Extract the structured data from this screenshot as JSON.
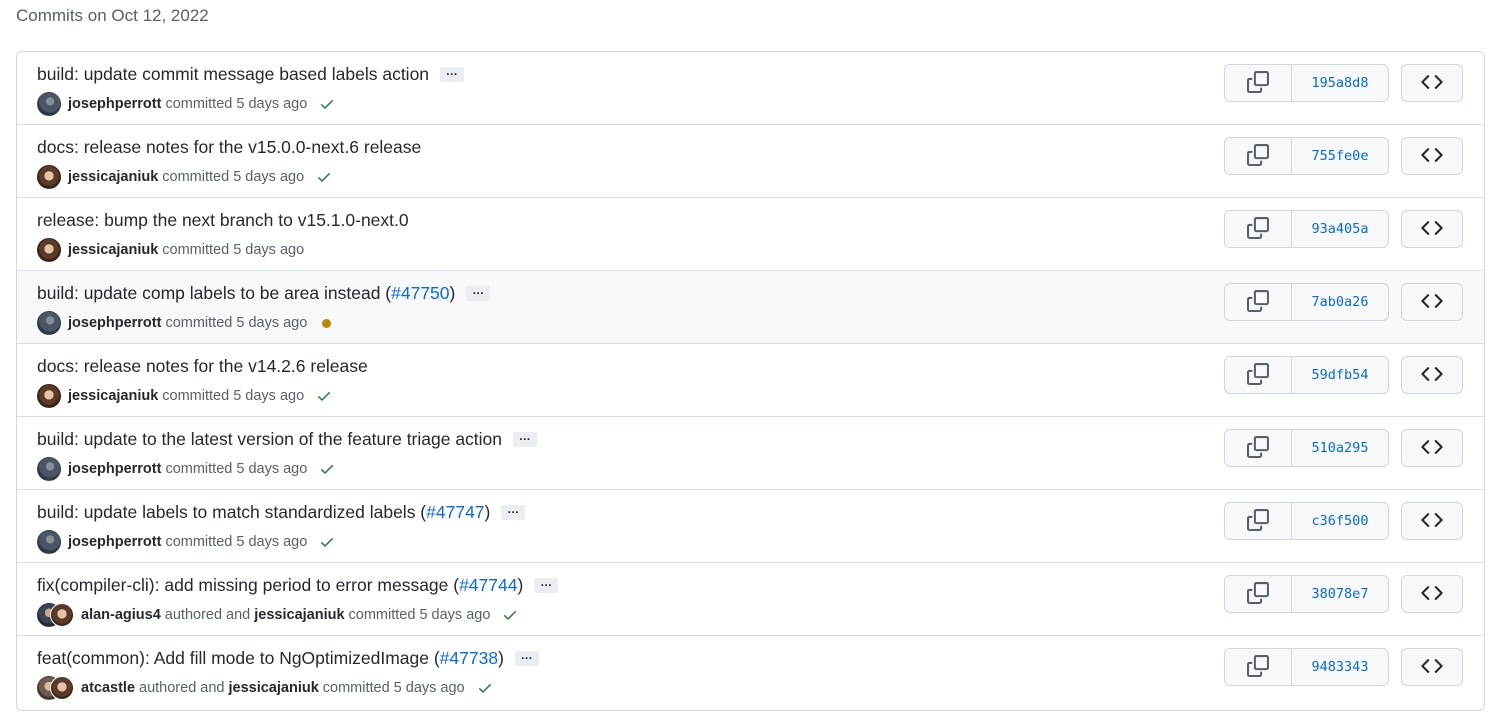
{
  "heading": "Commits on Oct 12, 2022",
  "colors": {
    "link": "#0969da",
    "success": "#1a7f37",
    "pending": "#bf8700"
  },
  "commits": [
    {
      "title": "build: update commit message based labels action",
      "pr": null,
      "title_after": null,
      "has_ellipsis": true,
      "author": "josephperrott",
      "author_avatar": "jp",
      "coauthor": null,
      "coauthor_avatar": null,
      "time_text": "committed 5 days ago",
      "status": "success",
      "sha": "195a8d8"
    },
    {
      "title": "docs: release notes for the v15.0.0-next.6 release",
      "pr": null,
      "title_after": null,
      "has_ellipsis": false,
      "author": "jessicajaniuk",
      "author_avatar": "jc",
      "coauthor": null,
      "coauthor_avatar": null,
      "time_text": "committed 5 days ago",
      "status": "success",
      "sha": "755fe0e"
    },
    {
      "title": "release: bump the next branch to v15.1.0-next.0",
      "pr": null,
      "title_after": null,
      "has_ellipsis": false,
      "author": "jessicajaniuk",
      "author_avatar": "jc",
      "coauthor": null,
      "coauthor_avatar": null,
      "time_text": "committed 5 days ago",
      "status": "none",
      "sha": "93a405a"
    },
    {
      "title": "build: update comp labels to be area instead (",
      "pr": "#47750",
      "title_after": ")",
      "has_ellipsis": true,
      "author": "josephperrott",
      "author_avatar": "jp",
      "coauthor": null,
      "coauthor_avatar": null,
      "time_text": "committed 5 days ago",
      "status": "pending",
      "sha": "7ab0a26"
    },
    {
      "title": "docs: release notes for the v14.2.6 release",
      "pr": null,
      "title_after": null,
      "has_ellipsis": false,
      "author": "jessicajaniuk",
      "author_avatar": "jc",
      "coauthor": null,
      "coauthor_avatar": null,
      "time_text": "committed 5 days ago",
      "status": "success",
      "sha": "59dfb54"
    },
    {
      "title": "build: update to the latest version of the feature triage action",
      "pr": null,
      "title_after": null,
      "has_ellipsis": true,
      "author": "josephperrott",
      "author_avatar": "jp",
      "coauthor": null,
      "coauthor_avatar": null,
      "time_text": "committed 5 days ago",
      "status": "success",
      "sha": "510a295"
    },
    {
      "title": "build: update labels to match standardized labels (",
      "pr": "#47747",
      "title_after": ")",
      "has_ellipsis": true,
      "author": "josephperrott",
      "author_avatar": "jp",
      "coauthor": null,
      "coauthor_avatar": null,
      "time_text": "committed 5 days ago",
      "status": "success",
      "sha": "c36f500"
    },
    {
      "title": "fix(compiler-cli): add missing period to error message (",
      "pr": "#47744",
      "title_after": ")",
      "has_ellipsis": true,
      "author": "alan-agius4",
      "author_avatar": "aa",
      "coauthor": "jessicajaniuk",
      "coauthor_avatar": "jc",
      "mid_text": "authored and",
      "time_text": "committed 5 days ago",
      "status": "success",
      "sha": "38078e7"
    },
    {
      "title": "feat(common): Add fill mode to NgOptimizedImage (",
      "pr": "#47738",
      "title_after": ")",
      "has_ellipsis": true,
      "author": "atcastle",
      "author_avatar": "at",
      "coauthor": "jessicajaniuk",
      "coauthor_avatar": "jc",
      "mid_text": "authored and",
      "time_text": "committed 5 days ago",
      "status": "success",
      "sha": "9483343"
    }
  ],
  "icons": {
    "copy": "copy-icon",
    "browse": "code-brackets-icon",
    "check": "check-icon",
    "ellipsis": "ellipsis-icon"
  },
  "hover_row_index": 3
}
